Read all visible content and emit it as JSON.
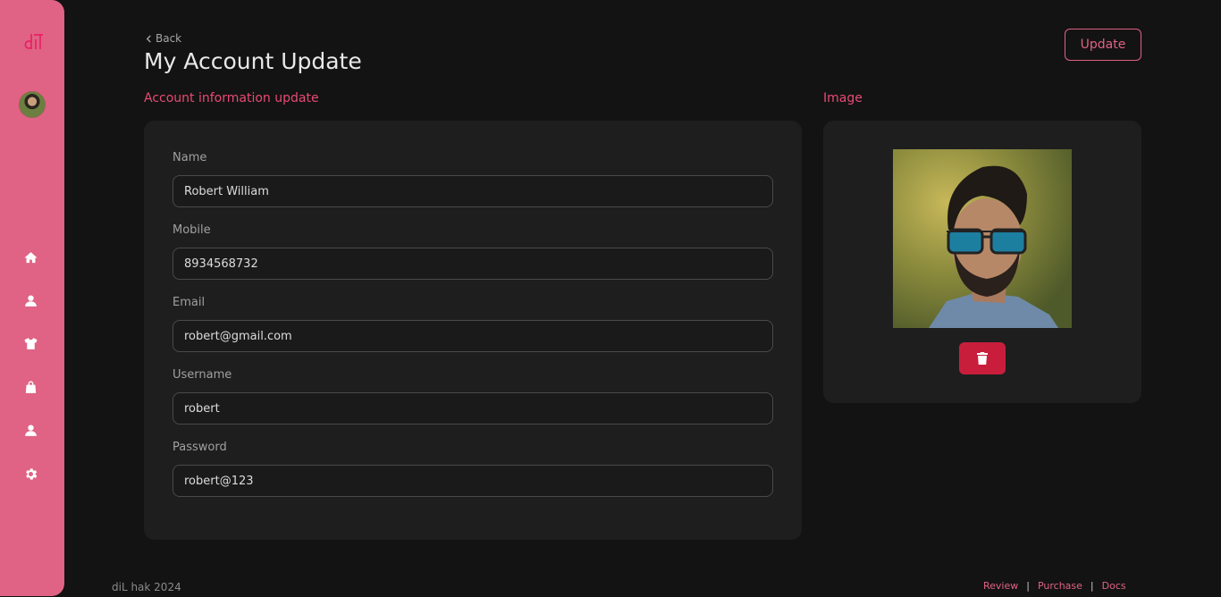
{
  "sidebar": {
    "logo_text": "d̄il",
    "nav": [
      {
        "name": "home",
        "icon": "home-icon"
      },
      {
        "name": "user",
        "icon": "user-icon"
      },
      {
        "name": "products",
        "icon": "tshirt-icon"
      },
      {
        "name": "orders",
        "icon": "shopping-bag-icon"
      },
      {
        "name": "account",
        "icon": "user-icon"
      },
      {
        "name": "settings",
        "icon": "gear-icon"
      }
    ]
  },
  "header": {
    "back_label": "Back",
    "title": "My Account Update",
    "update_label": "Update"
  },
  "form": {
    "section_title": "Account information update",
    "fields": [
      {
        "label": "Name",
        "value": "Robert William"
      },
      {
        "label": "Mobile",
        "value": "8934568732"
      },
      {
        "label": "Email",
        "value": "robert@gmail.com"
      },
      {
        "label": "Username",
        "value": "robert"
      },
      {
        "label": "Password",
        "value": "robert@123"
      }
    ]
  },
  "image": {
    "section_title": "Image",
    "delete_icon": "trash-icon"
  },
  "footer": {
    "copyright": "diL hak 2024",
    "links": [
      "Review",
      "Purchase",
      "Docs"
    ],
    "separator": "|"
  },
  "colors": {
    "accent": "#e06284",
    "accent_text": "#e84a75",
    "danger": "#c81e3c",
    "background": "#131313",
    "card": "#1e1e1e"
  }
}
